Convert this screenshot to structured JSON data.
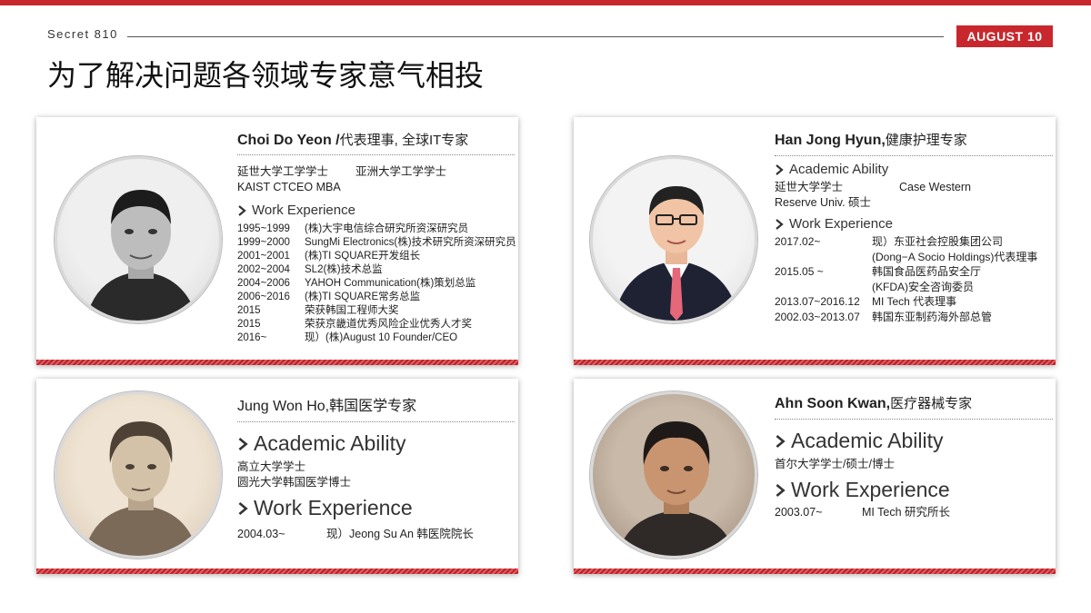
{
  "header": {
    "brand": "Secret 810",
    "badge": "AUGUST 10",
    "title": "为了解决问题各领域专家意气相投"
  },
  "colors": {
    "accent": "#c8282d"
  },
  "cards": [
    {
      "name": "Choi Do Yeon /",
      "role": "代表理事, 全球IT专家",
      "edu1a": "延世大学工学学士",
      "edu1b": "亚洲大学工学学士",
      "edu2": "KAIST CTCEO MBA",
      "work_label": "Work Experience",
      "rows": [
        [
          "1995~1999",
          "(株)大宇电信综合研究所资深研究员"
        ],
        [
          "1999~2000",
          "SungMi Electronics(株)技术研究所资深研究员"
        ],
        [
          "2001~2001",
          "(株)TI SQUARE开发组长"
        ],
        [
          "2002~2004",
          "SL2(株)技术总监"
        ],
        [
          "2004~2006",
          "YAHOH Communication(株)策划总监"
        ],
        [
          "2006~2016",
          "(株)TI SQUARE常务总监"
        ],
        [
          "2015",
          "荣获韩国工程师大奖"
        ],
        [
          "2015",
          "荣获京畿道优秀风险企业优秀人才奖"
        ],
        [
          "2016~",
          "现）(株)August 10 Founder/CEO"
        ]
      ]
    },
    {
      "name": "Han Jong Hyun,",
      "role": "健康护理专家",
      "academic_label": "Academic Ability",
      "edu1a": "延世大学学士",
      "edu1b": "Case Western",
      "edu2": "Reserve Univ. 硕士",
      "work_label": "Work Experience",
      "rows": [
        [
          "2017.02~",
          "现）东亚社会控股集团公司"
        ],
        [
          "",
          "(Dong−A Socio Holdings)代表理事"
        ],
        [
          "2015.05 ~",
          "韩国食品医药品安全厅"
        ],
        [
          "",
          "(KFDA)安全咨询委员"
        ],
        [
          "2013.07~2016.12",
          "MI Tech 代表理事"
        ],
        [
          "2002.03~2013.07",
          "韩国东亚制药海外部总管"
        ]
      ]
    },
    {
      "name": "Jung Won Ho,",
      "role": "韩国医学专家",
      "academic_label": "Academic Ability",
      "edu1": "高立大学学士",
      "edu2": "圆光大学韩国医学博士",
      "work_label": "Work Experience",
      "row_date": "2004.03~",
      "row_text": "现）Jeong Su An 韩医院院长"
    },
    {
      "name": "Ahn Soon Kwan,",
      "role": "医疗器械专家",
      "academic_label": "Academic Ability",
      "edu1": "首尔大学学士/硕士/博士",
      "work_label": "Work Experience",
      "row_date": "2003.07~",
      "row_text": "MI Tech  研究所长"
    }
  ]
}
